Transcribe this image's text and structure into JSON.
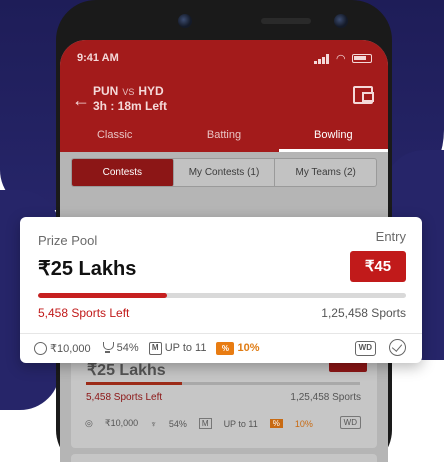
{
  "status_bar": {
    "time": "9:41 AM"
  },
  "match": {
    "team_a": "PUN",
    "vs": "VS",
    "team_b": "HYD",
    "time_left": "3h : 18m Left"
  },
  "tabs": [
    {
      "label": "Classic",
      "active": false
    },
    {
      "label": "Batting",
      "active": false
    },
    {
      "label": "Bowling",
      "active": true
    }
  ],
  "segments": [
    {
      "label": "Contests",
      "active": true
    },
    {
      "label": "My Contests (1)",
      "active": false
    },
    {
      "label": "My Teams (2)",
      "active": false
    }
  ],
  "contest_card": {
    "prize_pool_label": "Prize Pool",
    "prize_pool": "₹25 Lakhs",
    "entry_label": "Entry",
    "entry_fee": "₹45",
    "fill_fraction": 0.35,
    "spots_left": "5,458 Sports Left",
    "total_spots": "1,25,458 Sports",
    "first_prize": "₹10,000",
    "win_percent": "54%",
    "max_teams": "UP to 11",
    "bonus": "10%",
    "m_badge": "M",
    "bonus_badge": "%",
    "wd_badge": "WD"
  },
  "background_card": {
    "prize_pool": "₹25 Lakhs",
    "spots_left": "5,458 Sports Left",
    "total_spots": "1,25,458 Sports",
    "first_prize": "₹10,000",
    "win_percent": "54%",
    "max_teams": "UP to 11",
    "bonus": "10%",
    "m_badge": "M",
    "bonus_badge": "%",
    "wd_badge": "WD"
  },
  "colors": {
    "brand_red": "#a31b1b",
    "entry_red": "#c11a1a",
    "navy": "#262569",
    "bonus_orange": "#e87c12"
  }
}
